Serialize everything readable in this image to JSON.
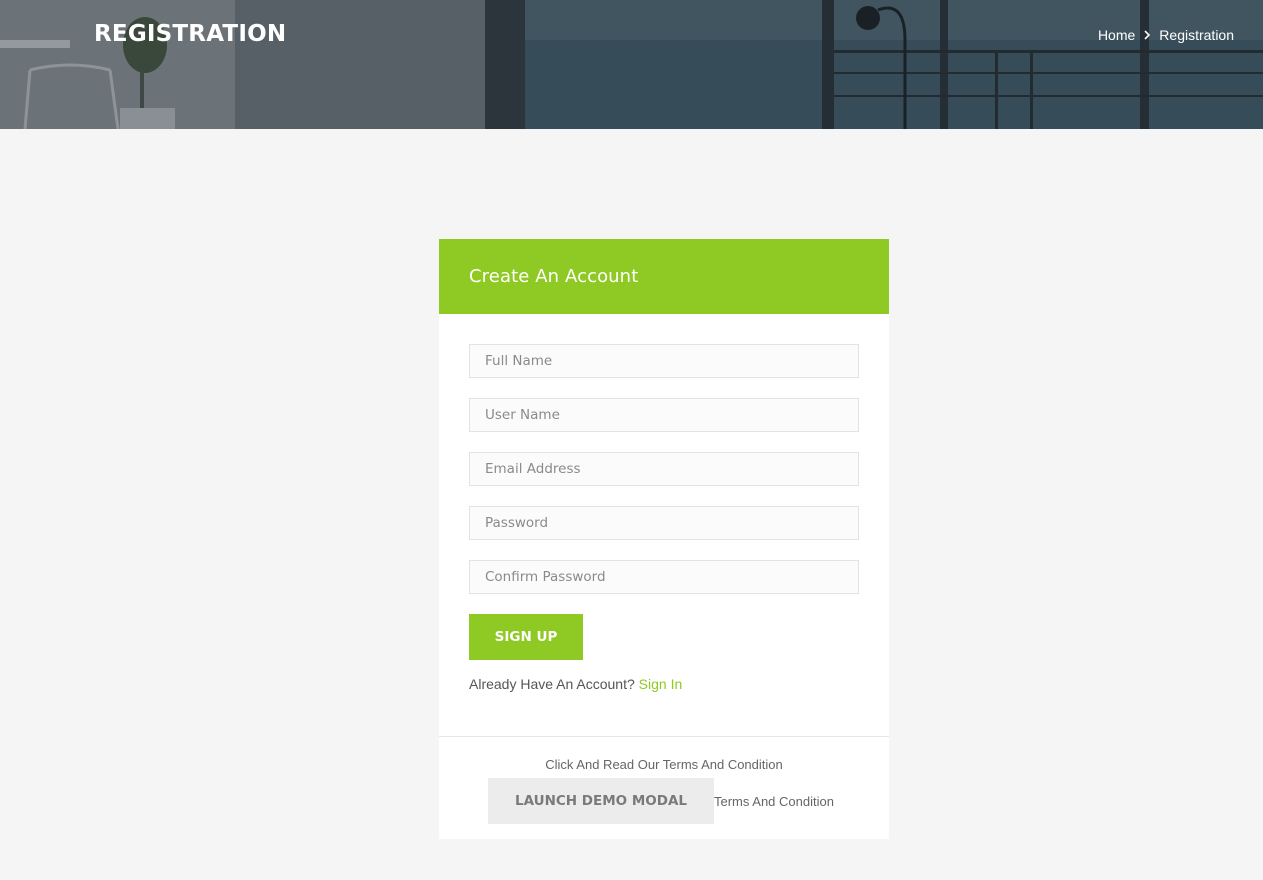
{
  "banner": {
    "title": "REGISTRATION",
    "breadcrumb": {
      "home": "Home",
      "separator_icon": "chevron-right-icon",
      "current": "Registration"
    }
  },
  "card": {
    "heading": "Create An Account",
    "fields": {
      "full_name": {
        "placeholder": "Full Name",
        "value": ""
      },
      "user_name": {
        "placeholder": "User Name",
        "value": ""
      },
      "email": {
        "placeholder": "Email Address",
        "value": ""
      },
      "password": {
        "placeholder": "Password",
        "value": ""
      },
      "confirm_password": {
        "placeholder": "Confirm Password",
        "value": ""
      }
    },
    "signup_label": "SIGN UP",
    "signin_prompt": "Already Have An Account?",
    "signin_link": "Sign In",
    "terms_caption": "Click And Read Our Terms And Condition",
    "modal_button": "LAUNCH DEMO MODAL",
    "terms_link": "Terms And Condition"
  },
  "colors": {
    "accent": "#8fc923",
    "page_bg": "#f5f5f5",
    "card_bg": "#ffffff",
    "modal_button_bg": "#ececec"
  }
}
